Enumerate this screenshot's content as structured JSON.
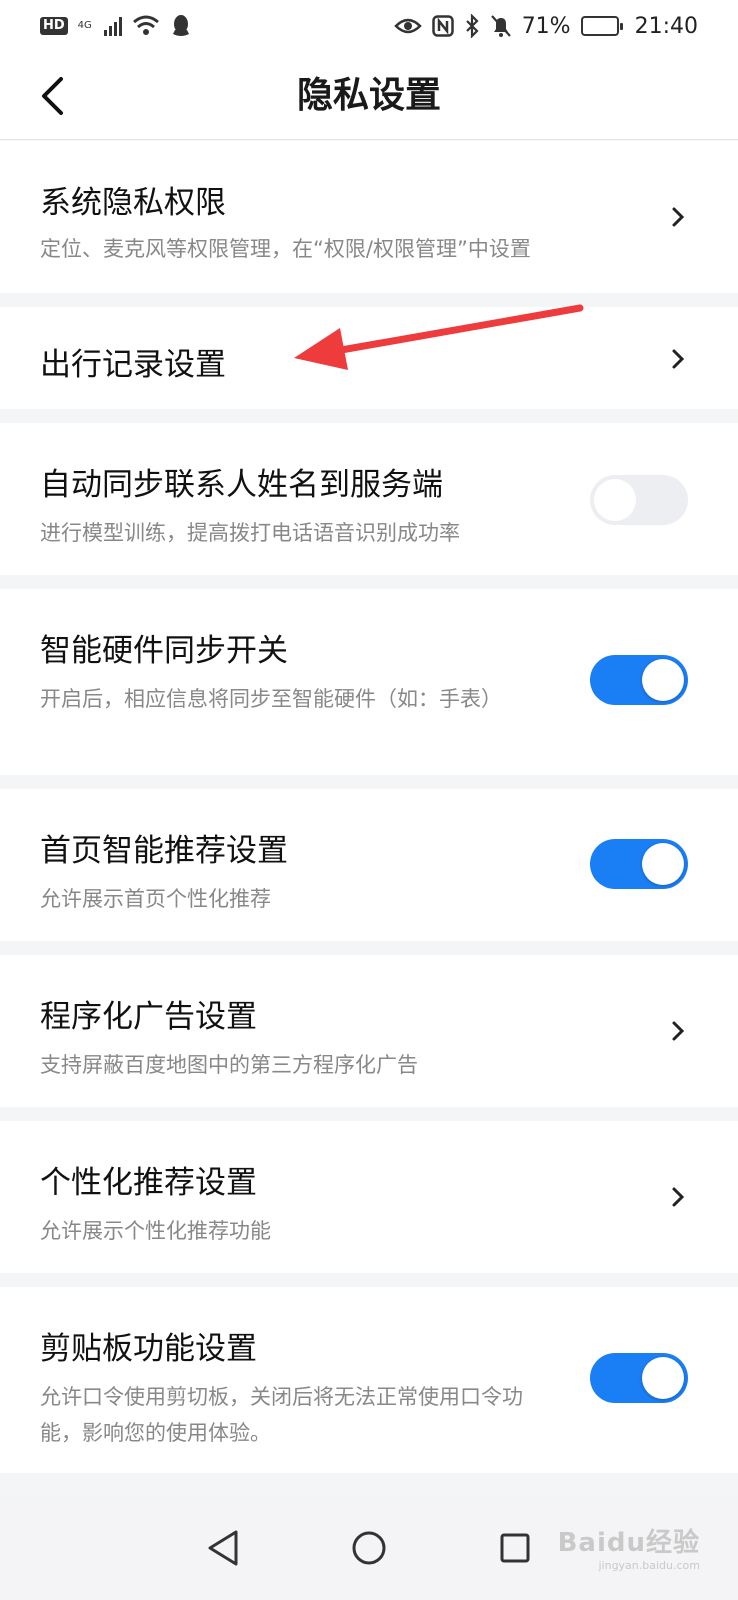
{
  "status_bar": {
    "network_badge": "HD",
    "network_type": "4G",
    "battery": "71%",
    "time": "21:40"
  },
  "header": {
    "title": "隐私设置"
  },
  "settings": [
    {
      "title": "系统隐私权限",
      "desc": "定位、麦克风等权限管理，在“权限/权限管理”中设置",
      "control": "chevron"
    },
    {
      "title": "出行记录设置",
      "desc": "",
      "control": "chevron"
    },
    {
      "title": "自动同步联系人姓名到服务端",
      "desc": "进行模型训练，提高拨打电话语音识别成功率",
      "control": "toggle",
      "on": false
    },
    {
      "title": "智能硬件同步开关",
      "desc": "开启后，相应信息将同步至智能硬件（如：手表）",
      "control": "toggle",
      "on": true
    },
    {
      "title": "首页智能推荐设置",
      "desc": "允许展示首页个性化推荐",
      "control": "toggle",
      "on": true
    },
    {
      "title": "程序化广告设置",
      "desc": "支持屏蔽百度地图中的第三方程序化广告",
      "control": "chevron"
    },
    {
      "title": "个性化推荐设置",
      "desc": "允许展示个性化推荐功能",
      "control": "chevron"
    },
    {
      "title": "剪贴板功能设置",
      "desc": "允许口令使用剪切板，关闭后将无法正常使用口令功能，影响您的使用体验。",
      "control": "toggle",
      "on": true
    }
  ],
  "watermark": {
    "text": "Baidu经验",
    "sub": "jingyan.baidu.com"
  },
  "colors": {
    "accent": "#1a7ef5",
    "annotation_arrow": "#ee3b3b"
  }
}
